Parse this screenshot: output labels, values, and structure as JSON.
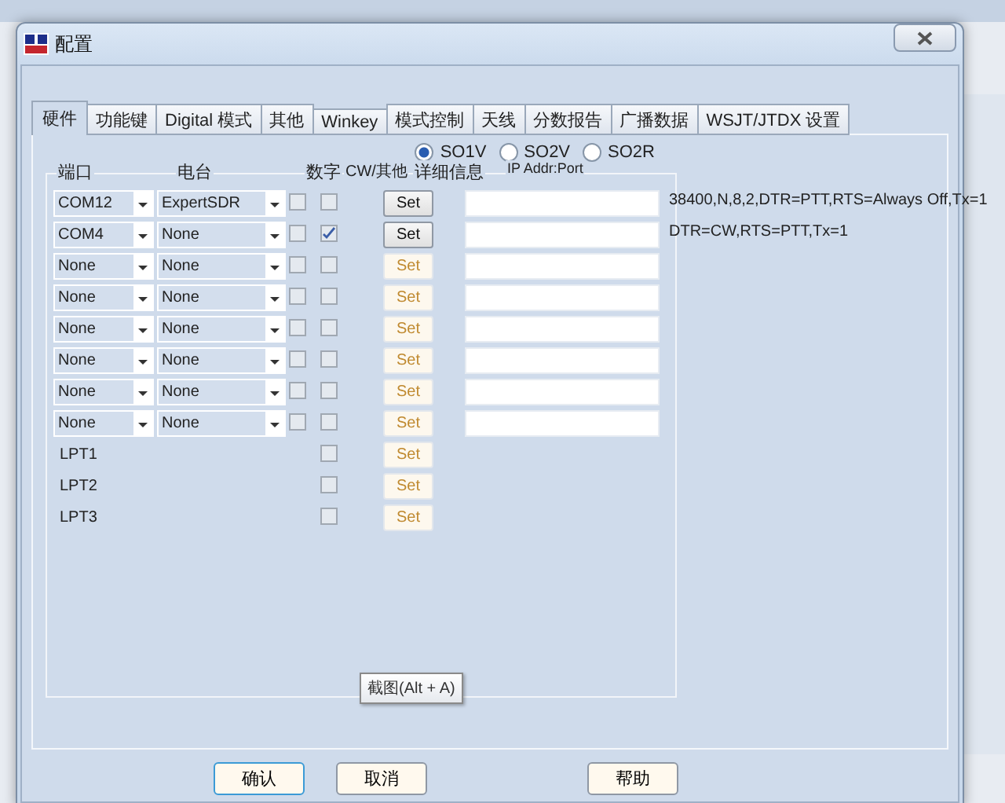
{
  "dialog": {
    "title": "配置",
    "tabs": [
      {
        "label": "硬件",
        "selected": true
      },
      {
        "label": "功能键",
        "selected": false
      },
      {
        "label": "Digital 模式",
        "selected": false
      },
      {
        "label": "其他",
        "selected": false
      },
      {
        "label": "Winkey",
        "selected": false
      },
      {
        "label": "模式控制",
        "selected": false
      },
      {
        "label": "天线",
        "selected": false
      },
      {
        "label": "分数报告",
        "selected": false
      },
      {
        "label": "广播数据",
        "selected": false
      },
      {
        "label": "WSJT/JTDX 设置",
        "selected": false
      }
    ],
    "station_mode": [
      {
        "label": "SO1V",
        "selected": true
      },
      {
        "label": "SO2V",
        "selected": false
      },
      {
        "label": "SO2R",
        "selected": false
      }
    ],
    "columns": {
      "port": "端口",
      "radio": "电台",
      "digital": "数字",
      "cw_other": "CW/其他",
      "details": "详细信息",
      "ip": "IP Addr:Port"
    },
    "rows": [
      {
        "kind": "com",
        "port": "COM12",
        "radio": "ExpertSDR",
        "digital": false,
        "cw": false,
        "set_label": "Set",
        "set_active": true,
        "info": "38400,N,8,2,DTR=PTT,RTS=Always Off,Tx=1"
      },
      {
        "kind": "com",
        "port": "COM4",
        "radio": "None",
        "digital": false,
        "cw": true,
        "set_label": "Set",
        "set_active": true,
        "info": "DTR=CW,RTS=PTT,Tx=1"
      },
      {
        "kind": "com",
        "port": "None",
        "radio": "None",
        "digital": false,
        "cw": false,
        "set_label": "Set",
        "set_active": false
      },
      {
        "kind": "com",
        "port": "None",
        "radio": "None",
        "digital": false,
        "cw": false,
        "set_label": "Set",
        "set_active": false
      },
      {
        "kind": "com",
        "port": "None",
        "radio": "None",
        "digital": false,
        "cw": false,
        "set_label": "Set",
        "set_active": false
      },
      {
        "kind": "com",
        "port": "None",
        "radio": "None",
        "digital": false,
        "cw": false,
        "set_label": "Set",
        "set_active": false
      },
      {
        "kind": "com",
        "port": "None",
        "radio": "None",
        "digital": false,
        "cw": false,
        "set_label": "Set",
        "set_active": false
      },
      {
        "kind": "com",
        "port": "None",
        "radio": "None",
        "digital": false,
        "cw": false,
        "set_label": "Set",
        "set_active": false
      },
      {
        "kind": "lpt",
        "port": "LPT1",
        "cw": false,
        "set_label": "Set",
        "set_active": false
      },
      {
        "kind": "lpt",
        "port": "LPT2",
        "cw": false,
        "set_label": "Set",
        "set_active": false
      },
      {
        "kind": "lpt",
        "port": "LPT3",
        "cw": false,
        "set_label": "Set",
        "set_active": false
      }
    ],
    "tooltip": "截图(Alt + A)",
    "buttons": [
      {
        "label": "确认",
        "default": true
      },
      {
        "label": "取消",
        "default": false
      },
      {
        "label": "帮助",
        "default": false
      }
    ]
  }
}
